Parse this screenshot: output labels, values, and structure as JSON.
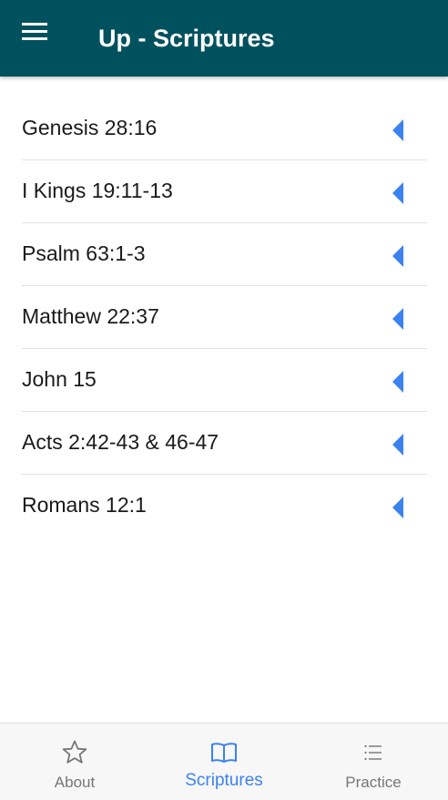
{
  "header": {
    "title": "Up - Scriptures",
    "menu_icon": "hamburger-menu-icon"
  },
  "scriptures": [
    {
      "label": "Genesis 28:16",
      "icon": "caret-left-icon"
    },
    {
      "label": "I Kings 19:11-13",
      "icon": "caret-left-icon"
    },
    {
      "label": "Psalm 63:1-3",
      "icon": "caret-left-icon"
    },
    {
      "label": "Matthew 22:37",
      "icon": "caret-left-icon"
    },
    {
      "label": "John 15",
      "icon": "caret-left-icon"
    },
    {
      "label": "Acts 2:42-43 & 46-47",
      "icon": "caret-left-icon"
    },
    {
      "label": "Romans 12:1",
      "icon": "caret-left-icon"
    }
  ],
  "bottom_nav": {
    "items": [
      {
        "label": "About",
        "icon": "star-icon",
        "active": false
      },
      {
        "label": "Scriptures",
        "icon": "open-book-icon",
        "active": true
      },
      {
        "label": "Practice",
        "icon": "list-icon",
        "active": false
      }
    ]
  },
  "colors": {
    "header_bg": "#00515e",
    "accent": "#3b82f0",
    "inactive": "#767676",
    "divider": "#e3e3e3",
    "nav_bg": "#f7f7f7"
  }
}
